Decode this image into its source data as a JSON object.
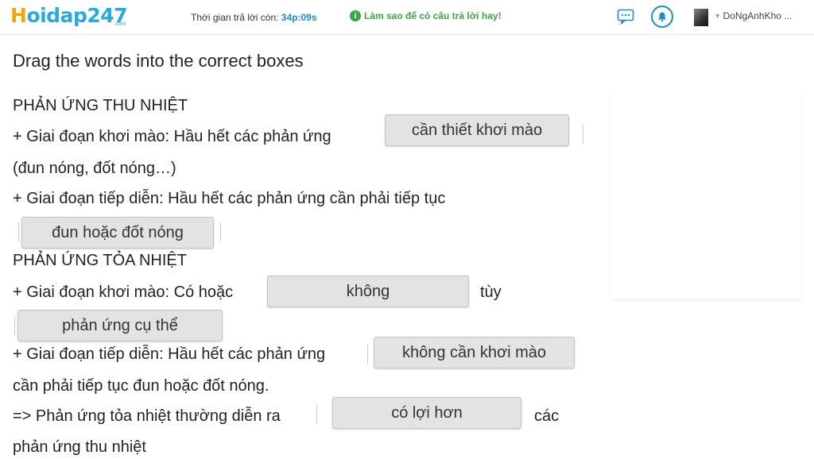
{
  "header": {
    "logo": "oidap247",
    "logo_letter": "H",
    "logo_sub": ".com",
    "timer_label": "Thời gian trả lời còn:",
    "timer_value": "34p:09s",
    "tip_text": "Làm sao để có câu trả lời hay!",
    "user_name": "DoNgAnhKho ..."
  },
  "question": {
    "instruction": "Drag the words into the correct boxes",
    "lines": [
      "PHẢN ỨNG THU NHIỆT",
      "+ Giai đoạn khơi mào: Hầu hết các phản ứng",
      "(đun nóng, đốt nóng…)",
      "+ Giai đoạn tiếp diễn: Hầu hết các phản ứng cần phải tiếp tục",
      "PHẢN ỨNG TỎA NHIỆT",
      "+ Giai đoạn khơi mào: Có hoặc",
      "tùy",
      "+ Giai đoạn tiếp diễn: Hầu hết các phản ứng",
      "cần phải tiếp tục đun hoặc đốt nóng.",
      "=> Phản ứng tỏa nhiệt thường diễn ra",
      "các",
      "phản ứng thu nhiệt"
    ],
    "boxes": [
      "cần thiết khơi mào",
      "đun hoặc đốt nóng",
      "không",
      "phản ứng cụ thể",
      "không cần khơi mào",
      "có lợi hơn"
    ]
  }
}
